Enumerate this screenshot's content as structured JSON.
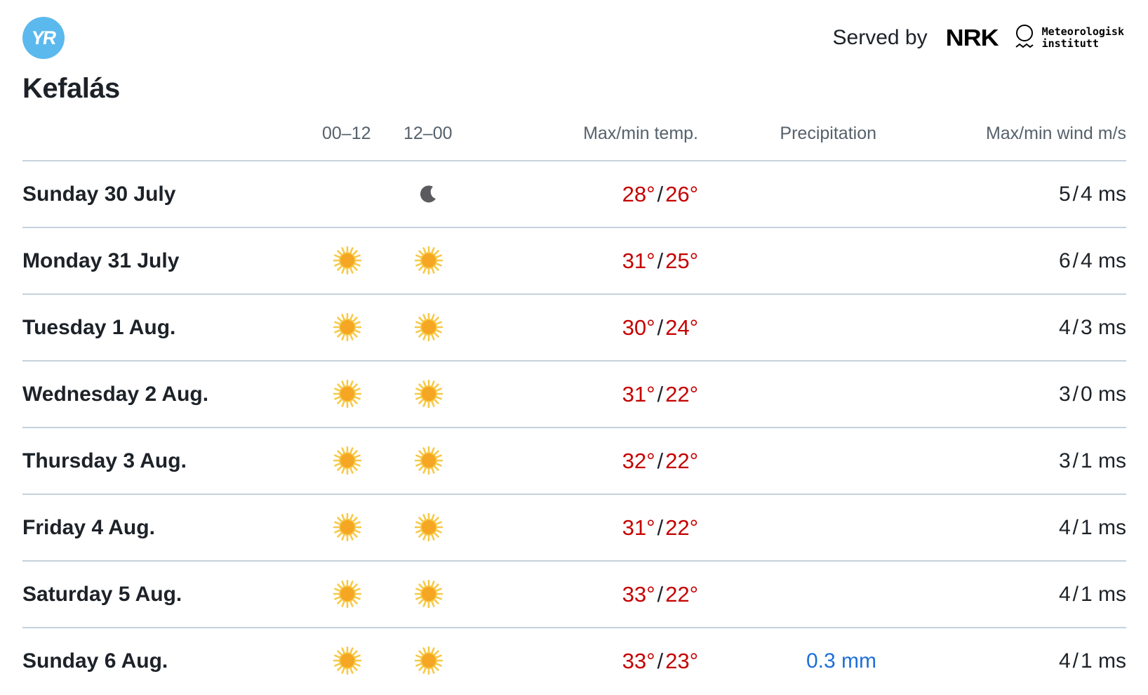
{
  "brand": {
    "logo_text": "YR"
  },
  "served_by": {
    "label": "Served by",
    "nrk": "NRK",
    "met_line1": "Meteorologisk",
    "met_line2": "institutt"
  },
  "location": {
    "name": "Kefalás"
  },
  "table": {
    "headers": {
      "night": "00–12",
      "day": "12–00",
      "temp": "Max/min temp.",
      "precip": "Precipitation",
      "wind": "Max/min wind m/s"
    },
    "rows": [
      {
        "day": "Sunday 30 July",
        "icon_00_12": "",
        "icon_12_00": "moon-icon",
        "temp_max": "28°",
        "temp_min": "26°",
        "precip": "",
        "wind_max": "5",
        "wind_min": "4 ms"
      },
      {
        "day": "Monday 31 July",
        "icon_00_12": "sun-icon",
        "icon_12_00": "sun-icon",
        "temp_max": "31°",
        "temp_min": "25°",
        "precip": "",
        "wind_max": "6",
        "wind_min": "4 ms"
      },
      {
        "day": "Tuesday 1 Aug.",
        "icon_00_12": "sun-icon",
        "icon_12_00": "sun-icon",
        "temp_max": "30°",
        "temp_min": "24°",
        "precip": "",
        "wind_max": "4",
        "wind_min": "3 ms"
      },
      {
        "day": "Wednesday 2 Aug.",
        "icon_00_12": "sun-icon",
        "icon_12_00": "sun-icon",
        "temp_max": "31°",
        "temp_min": "22°",
        "precip": "",
        "wind_max": "3",
        "wind_min": "0 ms"
      },
      {
        "day": "Thursday 3 Aug.",
        "icon_00_12": "sun-icon",
        "icon_12_00": "sun-icon",
        "temp_max": "32°",
        "temp_min": "22°",
        "precip": "",
        "wind_max": "3",
        "wind_min": "1 ms"
      },
      {
        "day": "Friday 4 Aug.",
        "icon_00_12": "sun-icon",
        "icon_12_00": "sun-icon",
        "temp_max": "31°",
        "temp_min": "22°",
        "precip": "",
        "wind_max": "4",
        "wind_min": "1 ms"
      },
      {
        "day": "Saturday 5 Aug.",
        "icon_00_12": "sun-icon",
        "icon_12_00": "sun-icon",
        "temp_max": "33°",
        "temp_min": "22°",
        "precip": "",
        "wind_max": "4",
        "wind_min": "1 ms"
      },
      {
        "day": "Sunday 6 Aug.",
        "icon_00_12": "sun-icon",
        "icon_12_00": "sun-icon",
        "temp_max": "33°",
        "temp_min": "23°",
        "precip": "0.3 mm",
        "wind_max": "4",
        "wind_min": "1 ms"
      }
    ]
  },
  "colors": {
    "brand_blue": "#5bb9ee",
    "temp_warm": "#c60000",
    "precip_blue": "#1e6fd9",
    "divider": "#c6d2dc",
    "sun_core": "#f5a623",
    "moon": "#5a5a5f"
  }
}
